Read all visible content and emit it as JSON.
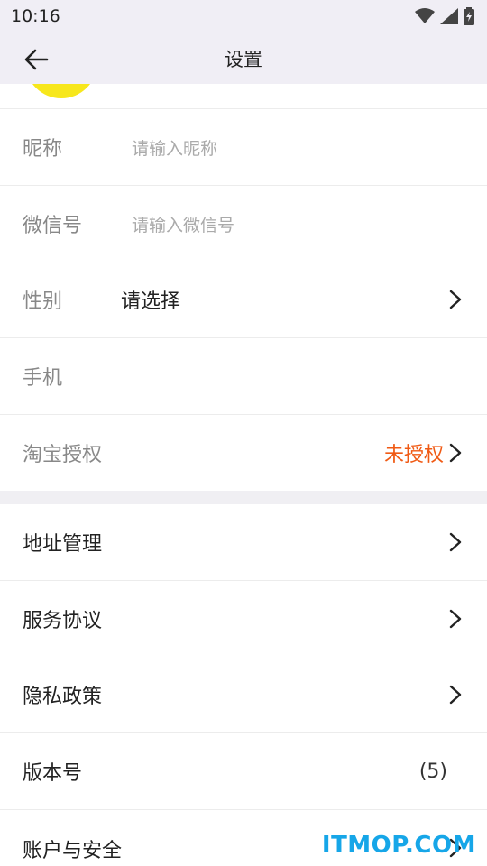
{
  "status_bar": {
    "time": "10:16",
    "icons": [
      "wifi-icon",
      "signal-icon",
      "battery-icon"
    ]
  },
  "header": {
    "title": "设置"
  },
  "avatar": {
    "color": "#f7e71c"
  },
  "profile_rows": [
    {
      "label": "昵称",
      "placeholder": "请输入昵称"
    },
    {
      "label": "微信号",
      "placeholder": "请输入微信号"
    },
    {
      "label": "性别",
      "value": "请选择"
    },
    {
      "label": "手机"
    },
    {
      "label": "淘宝授权",
      "status": "未授权"
    }
  ],
  "menu_rows": [
    {
      "label": "地址管理"
    },
    {
      "label": "服务协议"
    },
    {
      "label": "隐私政策"
    },
    {
      "label": "版本号",
      "count": "(5)"
    },
    {
      "label": "账户与安全"
    }
  ],
  "colors": {
    "header_bg": "#f0eef5",
    "status_red": "#f05a14",
    "watermark": "#16a6e8"
  },
  "watermark": "ITMOP.COM"
}
